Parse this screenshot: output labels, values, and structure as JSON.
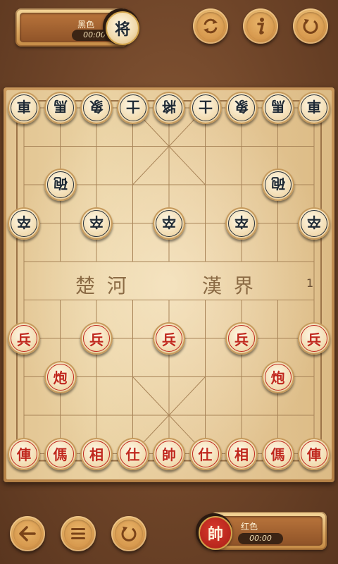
{
  "top_panel": {
    "name": "黑色",
    "timer": "00:00",
    "avatar_char": "将"
  },
  "bottom_panel": {
    "name": "红色",
    "timer": "00:00",
    "avatar_char": "帥"
  },
  "top_buttons": [
    {
      "name": "swap-sides-button",
      "icon": "swap-icon"
    },
    {
      "name": "info-button",
      "icon": "info-icon"
    },
    {
      "name": "restart-button",
      "icon": "refresh-icon"
    }
  ],
  "bottom_buttons": [
    {
      "name": "back-button",
      "icon": "arrow-left-icon"
    },
    {
      "name": "menu-button",
      "icon": "menu-icon"
    },
    {
      "name": "undo-button",
      "icon": "refresh-icon"
    }
  ],
  "river": {
    "left": "楚 河",
    "right": "漢 界"
  },
  "move_count": "1",
  "colors": {
    "red": "#c0281e",
    "black": "#1f2a35"
  },
  "pieces": {
    "black": [
      {
        "char": "車",
        "col": 0,
        "row": 0
      },
      {
        "char": "馬",
        "col": 1,
        "row": 0
      },
      {
        "char": "象",
        "col": 2,
        "row": 0
      },
      {
        "char": "士",
        "col": 3,
        "row": 0
      },
      {
        "char": "將",
        "col": 4,
        "row": 0
      },
      {
        "char": "士",
        "col": 5,
        "row": 0
      },
      {
        "char": "象",
        "col": 6,
        "row": 0
      },
      {
        "char": "馬",
        "col": 7,
        "row": 0
      },
      {
        "char": "車",
        "col": 8,
        "row": 0
      },
      {
        "char": "砲",
        "col": 1,
        "row": 2
      },
      {
        "char": "砲",
        "col": 7,
        "row": 2
      },
      {
        "char": "卒",
        "col": 0,
        "row": 3
      },
      {
        "char": "卒",
        "col": 2,
        "row": 3
      },
      {
        "char": "卒",
        "col": 4,
        "row": 3
      },
      {
        "char": "卒",
        "col": 6,
        "row": 3
      },
      {
        "char": "卒",
        "col": 8,
        "row": 3
      }
    ],
    "red": [
      {
        "char": "兵",
        "col": 0,
        "row": 6
      },
      {
        "char": "兵",
        "col": 2,
        "row": 6
      },
      {
        "char": "兵",
        "col": 4,
        "row": 6
      },
      {
        "char": "兵",
        "col": 6,
        "row": 6
      },
      {
        "char": "兵",
        "col": 8,
        "row": 6
      },
      {
        "char": "炮",
        "col": 1,
        "row": 7
      },
      {
        "char": "炮",
        "col": 7,
        "row": 7
      },
      {
        "char": "俥",
        "col": 0,
        "row": 9
      },
      {
        "char": "傌",
        "col": 1,
        "row": 9
      },
      {
        "char": "相",
        "col": 2,
        "row": 9
      },
      {
        "char": "仕",
        "col": 3,
        "row": 9
      },
      {
        "char": "帥",
        "col": 4,
        "row": 9
      },
      {
        "char": "仕",
        "col": 5,
        "row": 9
      },
      {
        "char": "相",
        "col": 6,
        "row": 9
      },
      {
        "char": "傌",
        "col": 7,
        "row": 9
      },
      {
        "char": "俥",
        "col": 8,
        "row": 9
      }
    ]
  }
}
